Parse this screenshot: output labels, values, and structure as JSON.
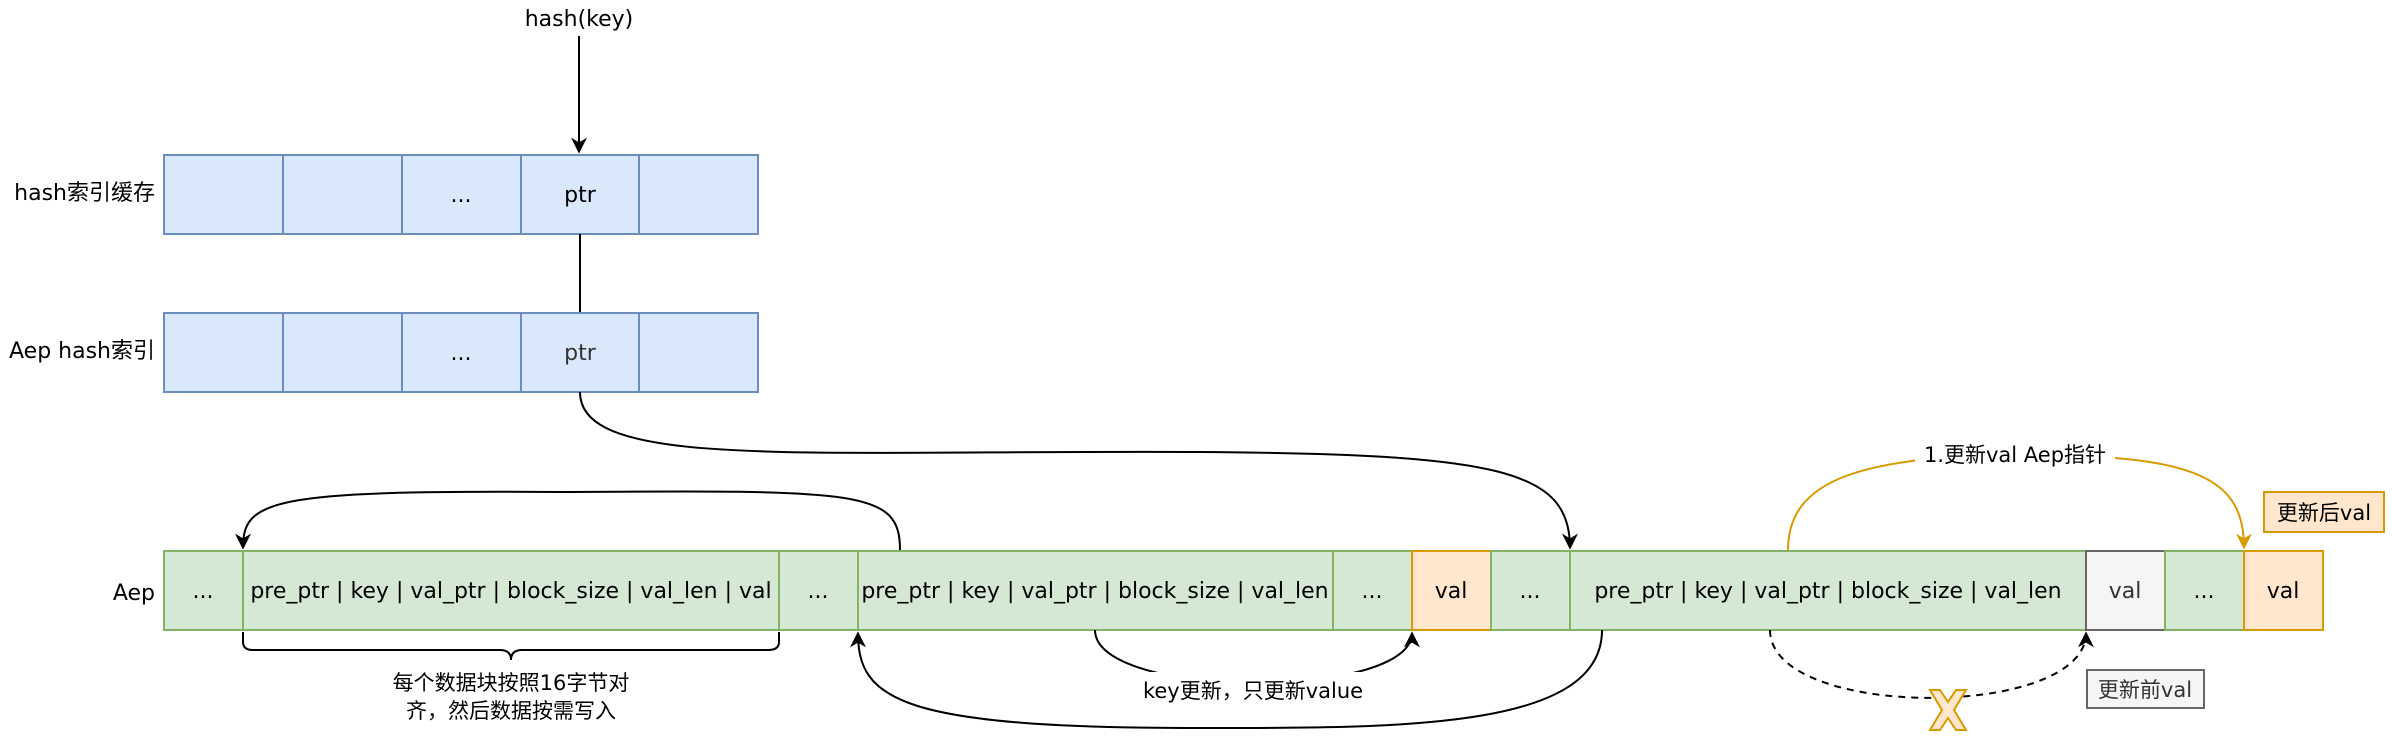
{
  "title": "hash(key)",
  "labels": {
    "cache_row": "hash索引缓存",
    "aep_index_row": "Aep hash索引",
    "aep_row": "Aep"
  },
  "cache_cells": [
    "",
    "",
    "...",
    "ptr",
    ""
  ],
  "aep_index_cells": [
    "",
    "",
    "...",
    "ptr",
    ""
  ],
  "aep_cells": [
    "...",
    "pre_ptr | key | val_ptr | block_size | val_len | val",
    "...",
    "pre_ptr | key | val_ptr | block_size | val_len",
    "...",
    "val",
    "...",
    "pre_ptr | key | val_ptr | block_size | val_len",
    "val",
    "...",
    "val"
  ],
  "annotations": {
    "align_note_line1": "每个数据块按照16字节对",
    "align_note_line2": "齐，然后数据按需写入",
    "key_update": "key更新，只更新value",
    "update_val_ptr": "1.更新val Aep指针",
    "after_val": "更新后val",
    "before_val": "更新前val"
  },
  "colors": {
    "index_fill": "#dae8fc",
    "index_stroke": "#6c8ebf",
    "block_fill": "#d5e8d4",
    "block_stroke": "#82b366",
    "val_fill": "#ffe6cc",
    "val_stroke": "#d79b00",
    "old_val_fill": "#f5f5f5",
    "old_val_stroke": "#666666",
    "update_arrow": "#d79b00",
    "invalid_mark": "#ffe6cc"
  }
}
